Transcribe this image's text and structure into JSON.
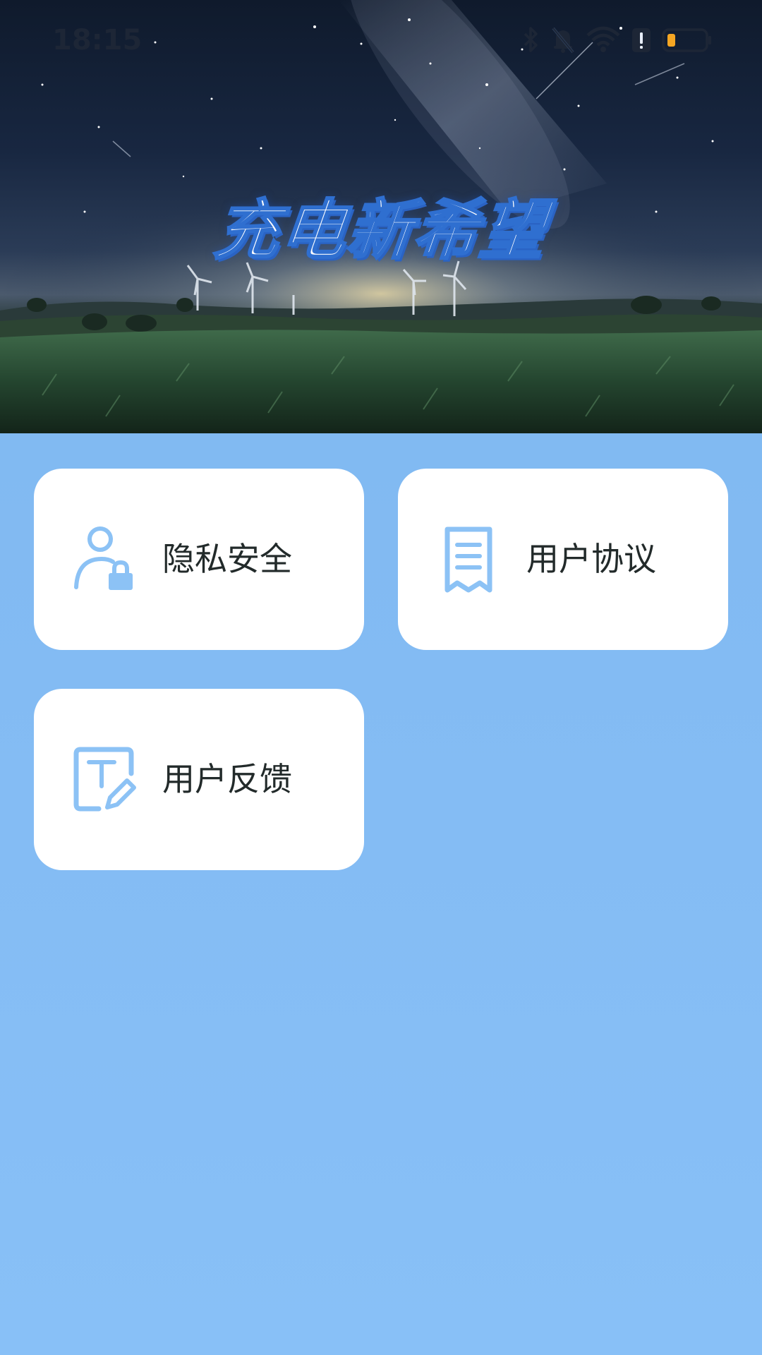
{
  "status_bar": {
    "time": "18:15",
    "icons": [
      "bluetooth-icon",
      "mute-bell-icon",
      "wifi-icon",
      "alert-sim-icon",
      "battery-low-icon"
    ],
    "battery_color": "#f5a623"
  },
  "banner": {
    "title": "充电新希望",
    "title_color": "#ffffff",
    "title_outline_color": "#2f6fd0"
  },
  "menu": {
    "items": [
      {
        "label": "隐私安全",
        "icon": "user-lock-icon"
      },
      {
        "label": "用户协议",
        "icon": "document-receipt-icon"
      },
      {
        "label": "用户反馈",
        "icon": "text-edit-icon"
      }
    ],
    "icon_color": "#8cc2f5",
    "card_background": "#ffffff"
  },
  "page": {
    "background_color": "#83bbf3"
  }
}
